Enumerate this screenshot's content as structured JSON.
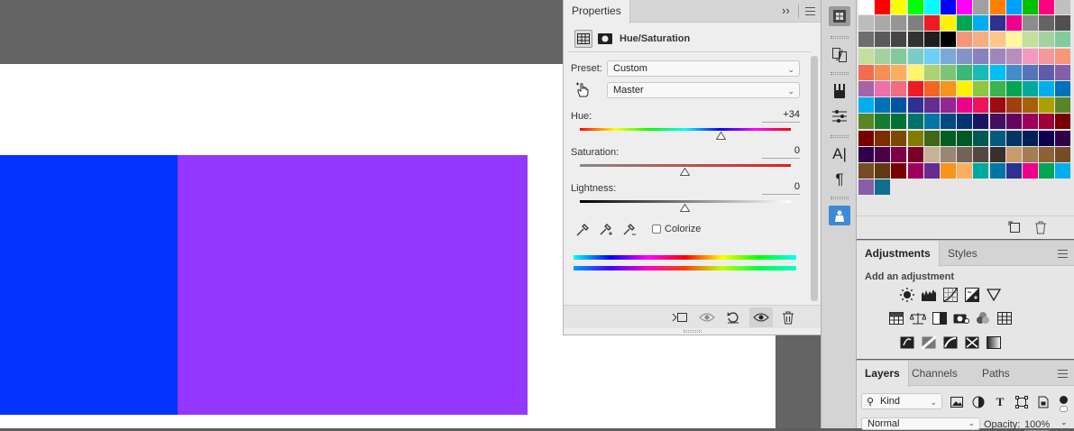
{
  "colors": {
    "blue_rect": "#0433ff",
    "purple_rect": "#9437ff",
    "accent": "#3d89d6"
  },
  "properties": {
    "tab_label": "Properties",
    "expand_glyph": "››",
    "adjustment_title": "Hue/Saturation",
    "preset_label": "Preset:",
    "preset_value": "Custom",
    "channel_value": "Master",
    "hue_label": "Hue:",
    "hue_value": "+34",
    "hue_level": 0.67,
    "saturation_label": "Saturation:",
    "saturation_value": "0",
    "lightness_label": "Lightness:",
    "lightness_value": "0",
    "colorize_label": "Colorize",
    "colorize_checked": false
  },
  "adjustments": {
    "tabs": [
      "Adjustments",
      "Styles"
    ],
    "subtitle": "Add an adjustment"
  },
  "layers": {
    "tabs": [
      "Layers",
      "Channels",
      "Paths"
    ],
    "kind_label": "Kind",
    "blend_mode": "Normal",
    "opacity_label": "Opacity:",
    "opacity_value": "100%"
  },
  "swatches": [
    [
      "#ffffff",
      "#ff0000",
      "#ffff00",
      "#00ff00",
      "#00ffff",
      "#0000ff",
      "#ff00ff",
      "#a0a0a0",
      "#ff8000",
      "#00a0ff",
      "#00c000",
      "#ff0080",
      "#c0c0c0"
    ],
    [
      "#bcbcbc",
      "#a9a9a9",
      "#959595",
      "#7f7f7f",
      "#ed1c24",
      "#fff200",
      "#00a651",
      "#00aeef",
      "#2e3192",
      "#ec008c",
      "#8c8c8c",
      "#646464",
      "#505050"
    ],
    [
      "#6e6e6e",
      "#5a5a5a",
      "#464646",
      "#323232",
      "#1e1e1e",
      "#000000",
      "#f69679",
      "#f9ad81",
      "#fdc689",
      "#fff799",
      "#c4df9b",
      "#a3d39c",
      "#82ca9c"
    ],
    [
      "#c4df9b",
      "#a3d39c",
      "#82ca9c",
      "#7accc8",
      "#6dcff6",
      "#7da7d9",
      "#8393ca",
      "#8781bd",
      "#a186be",
      "#bd8cbf",
      "#f49ac1",
      "#f5989d",
      "#f7977a"
    ],
    [
      "#f26c4f",
      "#f68e56",
      "#fbaf5d",
      "#fff568",
      "#acd373",
      "#7cc576",
      "#3bb878",
      "#1abbb4",
      "#00bff3",
      "#438ccb",
      "#5574b9",
      "#605ca8",
      "#855fa8"
    ],
    [
      "#a763a8",
      "#f06eaa",
      "#f26d7d",
      "#ed1c24",
      "#f26522",
      "#f7941d",
      "#fff200",
      "#8dc63f",
      "#39b54a",
      "#00a651",
      "#00a99d",
      "#00aeef",
      "#0072bc"
    ],
    [
      "#00aeef",
      "#0072bc",
      "#0054a6",
      "#2e3192",
      "#662d91",
      "#92278f",
      "#ec008c",
      "#ed145b",
      "#9e0b0f",
      "#a0410d",
      "#a36209",
      "#aba000",
      "#598527"
    ],
    [
      "#598527",
      "#197b30",
      "#007236",
      "#00746b",
      "#0076a3",
      "#004b80",
      "#003471",
      "#1b1464",
      "#440e62",
      "#630460",
      "#9e005d",
      "#9e0039",
      "#790000"
    ],
    [
      "#790000",
      "#7b2e00",
      "#7d4900",
      "#827b00",
      "#406618",
      "#005e20",
      "#005826",
      "#005952",
      "#005b7f",
      "#003663",
      "#002157",
      "#0d004c",
      "#32004b"
    ],
    [
      "#32004b",
      "#4b0049",
      "#7b0046",
      "#7a0026",
      "#c7b299",
      "#998675",
      "#736357",
      "#534741",
      "#37302d",
      "#c69c6d",
      "#a67c52",
      "#8c6239",
      "#754c24"
    ],
    [
      "#754c24",
      "#603913",
      "#790000",
      "#9e005d",
      "#662d91",
      "#f7941d",
      "#fbaf5d",
      "#00a99d",
      "#0076a3",
      "#2e3192",
      "#ec008c",
      "#00a651",
      "#00aeef"
    ],
    [
      "#8560a8",
      "#0e6f91"
    ]
  ]
}
